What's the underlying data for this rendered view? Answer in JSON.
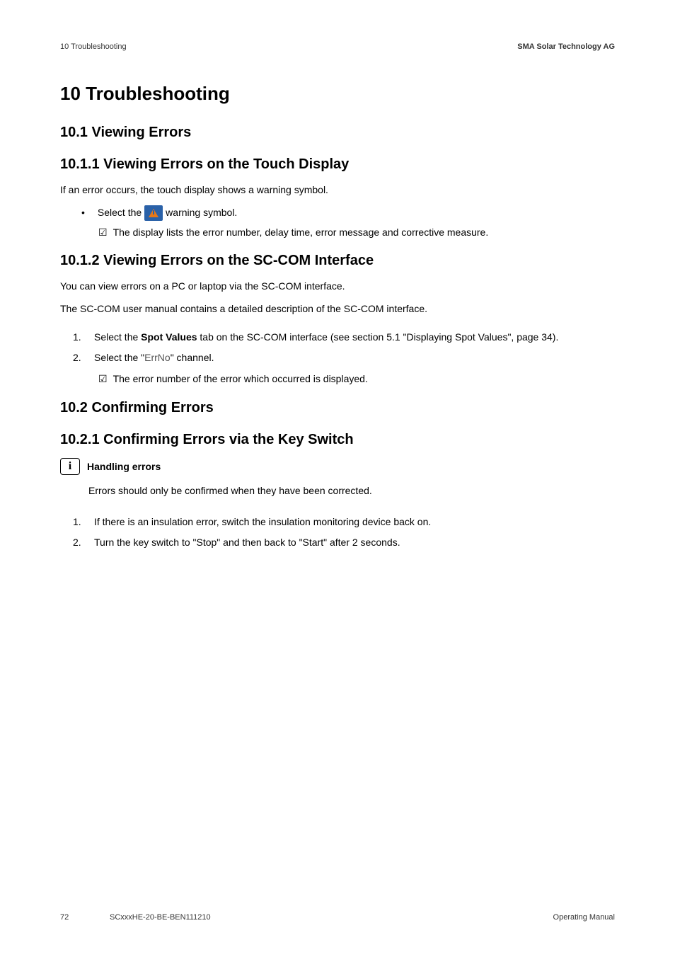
{
  "header": {
    "left": "10 Troubleshooting",
    "right": "SMA Solar Technology AG"
  },
  "title": "10  Troubleshooting",
  "section_10_1": "10.1  Viewing Errors",
  "section_10_1_1": {
    "heading": "10.1.1  Viewing Errors on the Touch Display",
    "intro": "If an error occurs, the touch display shows a warning symbol.",
    "bullet_prefix": "Select the",
    "bullet_suffix": "warning symbol.",
    "check": "The display lists the error number, delay time, error message and corrective measure."
  },
  "section_10_1_2": {
    "heading": "10.1.2  Viewing Errors on the SC-COM Interface",
    "p1": "You can view errors on a PC or laptop via the SC-COM interface.",
    "p2": "The SC-COM user manual contains a detailed description of the SC-COM interface.",
    "step1_a": "Select the ",
    "step1_bold": "Spot Values",
    "step1_b": " tab on the SC-COM interface (see section 5.1 \"Displaying Spot Values\", page 34).",
    "step2_a": "Select the \"",
    "step2_mono": "ErrNo",
    "step2_b": "\" channel.",
    "check": "The error number of the error which occurred is displayed."
  },
  "section_10_2": "10.2  Confirming Errors",
  "section_10_2_1": {
    "heading": "10.2.1  Confirming Errors via the Key Switch",
    "info_title": "Handling errors",
    "info_text": "Errors should only be confirmed when they have been corrected.",
    "step1": "If there is an insulation error, switch the insulation monitoring device back on.",
    "step2": "Turn the key switch to \"Stop\" and then back to \"Start\" after 2 seconds."
  },
  "footer": {
    "page": "72",
    "doc": "SCxxxHE-20-BE-BEN111210",
    "manual": "Operating Manual"
  },
  "labels": {
    "num1": "1.",
    "num2": "2.",
    "check": "☑",
    "bullet": "•",
    "info": "i"
  }
}
